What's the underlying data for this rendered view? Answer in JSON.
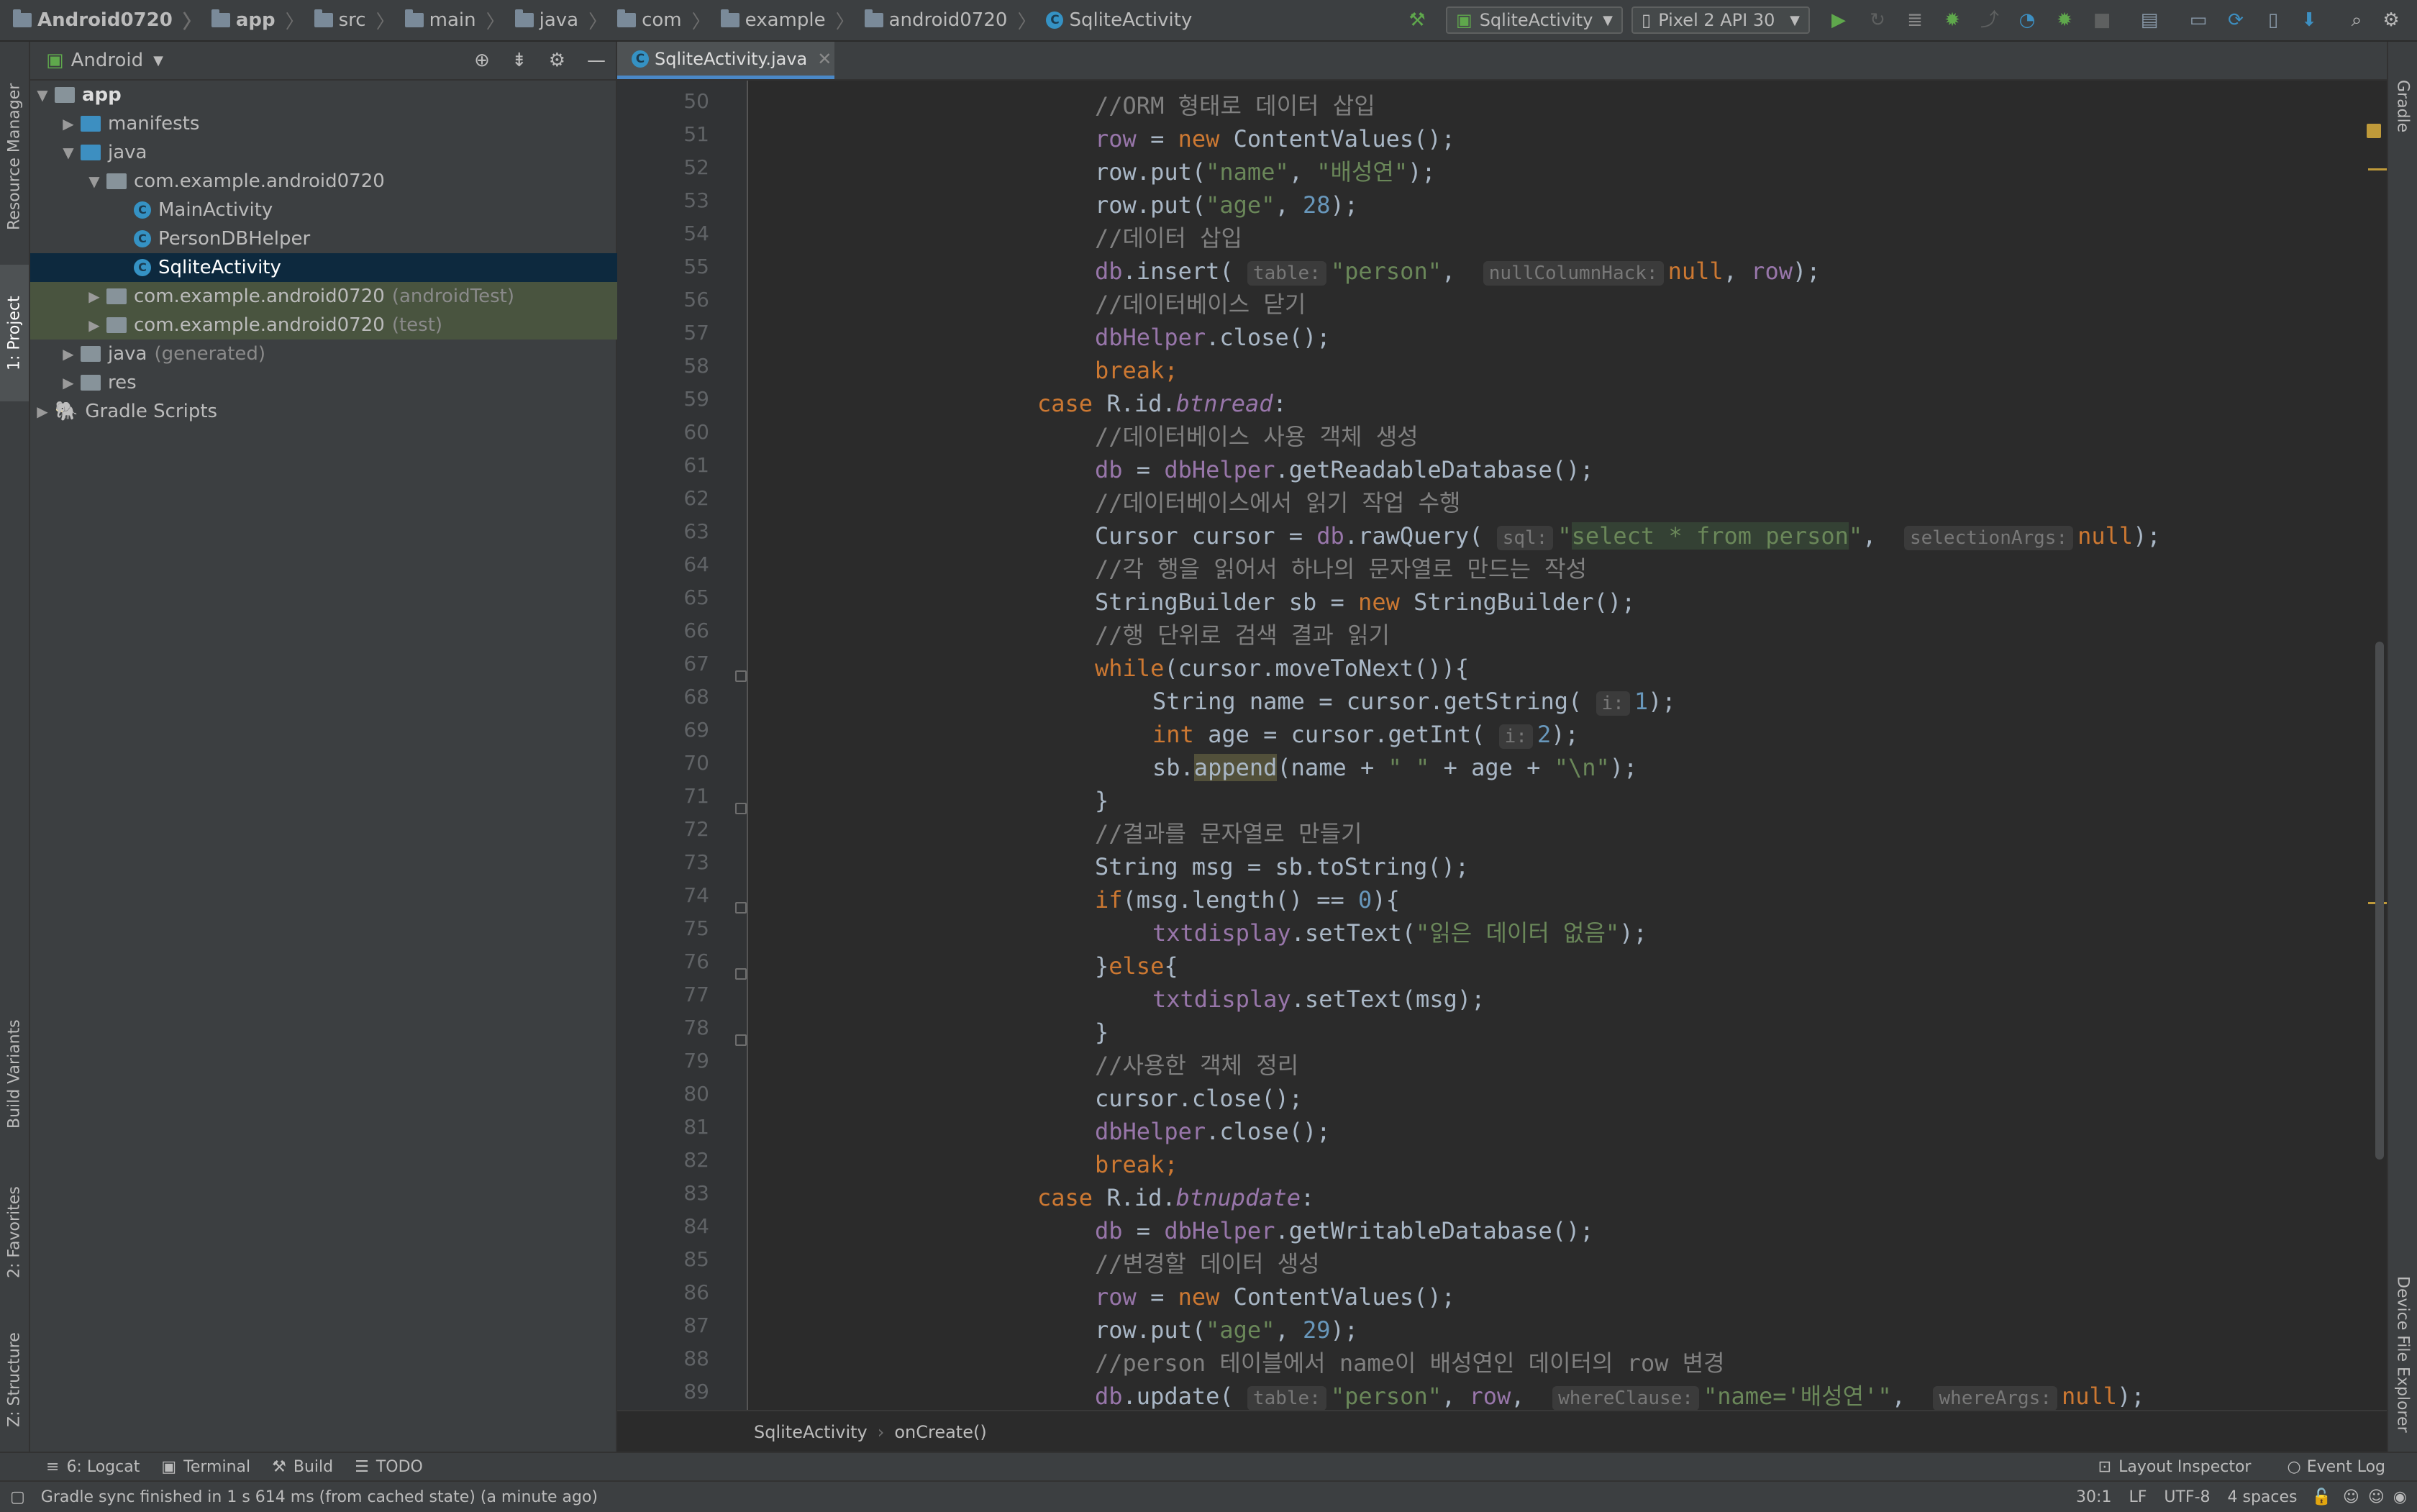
{
  "nav_bar": {
    "crumbs": [
      "Android0720",
      "app",
      "src",
      "main",
      "java",
      "com",
      "example",
      "android0720",
      "SqliteActivity"
    ],
    "run_config": "SqliteActivity",
    "device": "Pixel 2 API 30"
  },
  "left_strip": {
    "tabs": [
      "Resource Manager",
      "1: Project",
      "Build Variants",
      "2: Favorites",
      "Z: Structure"
    ]
  },
  "right_strip": {
    "tabs": [
      "Gradle",
      "Device File Explorer"
    ]
  },
  "project_panel": {
    "view_mode": "Android",
    "tree": [
      {
        "label": "app",
        "suffix": ""
      },
      {
        "label": "manifests",
        "suffix": ""
      },
      {
        "label": "java",
        "suffix": ""
      },
      {
        "label": "com.example.android0720",
        "suffix": ""
      },
      {
        "label": "MainActivity",
        "suffix": ""
      },
      {
        "label": "PersonDBHelper",
        "suffix": ""
      },
      {
        "label": "SqliteActivity",
        "suffix": ""
      },
      {
        "label": "com.example.android0720",
        "suffix": "(androidTest)"
      },
      {
        "label": "com.example.android0720",
        "suffix": "(test)"
      },
      {
        "label": "java",
        "suffix": "(generated)"
      },
      {
        "label": "res",
        "suffix": ""
      },
      {
        "label": "Gradle Scripts",
        "suffix": ""
      }
    ]
  },
  "editor": {
    "tab_label": "SqliteActivity.java",
    "line_numbers": [
      "50",
      "51",
      "52",
      "53",
      "54",
      "55",
      "56",
      "57",
      "58",
      "59",
      "60",
      "61",
      "62",
      "63",
      "64",
      "65",
      "66",
      "67",
      "68",
      "69",
      "70",
      "71",
      "72",
      "73",
      "74",
      "75",
      "76",
      "77",
      "78",
      "79",
      "80",
      "81",
      "82",
      "83",
      "84",
      "85",
      "86",
      "87",
      "88",
      "89"
    ],
    "lines": {
      "l50": "//ORM 형태로 데이터 삽입",
      "l51": [
        "row",
        " = ",
        "new",
        " ContentValues();"
      ],
      "l52": [
        "row.put(",
        "\"name\"",
        ", ",
        "\"배성연\"",
        ");"
      ],
      "l53": [
        "row.put(",
        "\"age\"",
        ", ",
        "28",
        ");"
      ],
      "l54": "//데이터 삽입",
      "l55": [
        "db",
        ".insert( ",
        "table:",
        "\"person\"",
        ",  ",
        "nullColumnHack:",
        "null",
        ", ",
        "row",
        ");"
      ],
      "l56": "//데이터베이스 닫기",
      "l57": [
        "dbHelper",
        ".close();"
      ],
      "l58": "break;",
      "l59": [
        "case",
        " R.id.",
        "btnread",
        ":"
      ],
      "l60": "//데이터베이스 사용 객체 생성",
      "l61": [
        "db",
        " = ",
        "dbHelper",
        ".getReadableDatabase();"
      ],
      "l62": "//데이터베이스에서 읽기 작업 수행",
      "l63": [
        "Cursor cursor = ",
        "db",
        ".rawQuery( ",
        "sql:",
        "\"",
        "select * from person",
        "\"",
        ",  ",
        "selectionArgs:",
        "null",
        ");"
      ],
      "l64": "//각 행을 읽어서 하나의 문자열로 만드는 작성",
      "l65": [
        "StringBuilder sb = ",
        "new",
        " StringBuilder();"
      ],
      "l66": "//행 단위로 검색 결과 읽기",
      "l67": [
        "while",
        "(cursor.moveToNext()){"
      ],
      "l68": [
        "String name = cursor.getString( ",
        "i:",
        "1",
        ");"
      ],
      "l69": [
        "int",
        " age = cursor.getInt( ",
        "i:",
        "2",
        ");"
      ],
      "l70": [
        "sb.",
        "append",
        "(name + ",
        "\" \"",
        " + age + ",
        "\"\\n\"",
        ");"
      ],
      "l71": "}",
      "l72": "//결과를 문자열로 만들기",
      "l73": "String msg = sb.toString();",
      "l74": [
        "if",
        "(msg.length() == ",
        "0",
        "){"
      ],
      "l75": [
        "txtdisplay",
        ".setText(",
        "\"읽은 데이터 없음\"",
        ");"
      ],
      "l76": [
        "}",
        "else",
        "{"
      ],
      "l77": [
        "txtdisplay",
        ".setText(msg);"
      ],
      "l78": "}",
      "l79": "//사용한 객체 정리",
      "l80": "cursor.close();",
      "l81": [
        "dbHelper",
        ".close();"
      ],
      "l82": "break;",
      "l83": [
        "case",
        " R.id.",
        "btnupdate",
        ":"
      ],
      "l84": [
        "db",
        " = ",
        "dbHelper",
        ".getWritableDatabase();"
      ],
      "l85": "//변경할 데이터 생성",
      "l86": [
        "row",
        " = ",
        "new",
        " ContentValues();"
      ],
      "l87": [
        "row.put(",
        "\"age\"",
        ", ",
        "29",
        ");"
      ],
      "l88": "//person 테이블에서 name이 배성연인 데이터의 row 변경",
      "l89": [
        "db",
        ".update( ",
        "table:",
        "\"person\"",
        ", ",
        "row",
        ",  ",
        "whereClause:",
        "\"name='배성연'\"",
        ",  ",
        "whereArgs:",
        "null",
        ");"
      ]
    },
    "breadcrumb": [
      "SqliteActivity",
      "onCreate()"
    ]
  },
  "tool_windows": {
    "left": [
      "6: Logcat",
      "Terminal",
      "Build",
      "TODO"
    ],
    "right": [
      "Layout Inspector",
      "Event Log"
    ]
  },
  "status_bar": {
    "message": "Gradle sync finished in 1 s 614 ms (from cached state) (a minute ago)",
    "position": "30:1",
    "line_sep": "LF",
    "encoding": "UTF-8",
    "indent": "4 spaces"
  },
  "colors": {
    "keyword": "#cc7832",
    "string": "#6a8759",
    "comment": "#808080",
    "field": "#9876aa",
    "number": "#6897bb",
    "selection": "#0d293e",
    "accent": "#4a88c7"
  }
}
